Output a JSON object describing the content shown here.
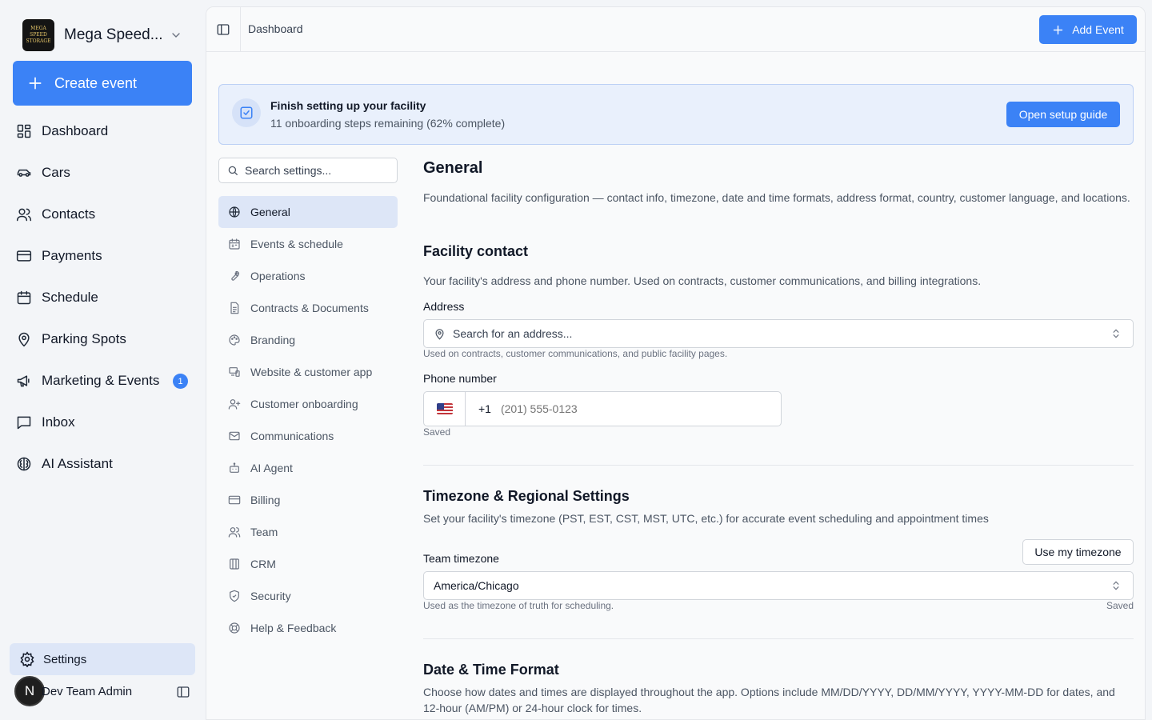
{
  "app": {
    "brand_name": "Mega Speed...",
    "brand_logo_text": "MEGA SPEED STORAGE",
    "create_event_label": "Create event"
  },
  "sidebar": {
    "items": [
      {
        "label": "Dashboard",
        "icon": "dashboard-icon"
      },
      {
        "label": "Cars",
        "icon": "car-icon"
      },
      {
        "label": "Contacts",
        "icon": "contacts-icon"
      },
      {
        "label": "Payments",
        "icon": "credit-card-icon"
      },
      {
        "label": "Schedule",
        "icon": "calendar-icon"
      },
      {
        "label": "Parking Spots",
        "icon": "map-pin-icon"
      },
      {
        "label": "Marketing & Events",
        "icon": "megaphone-icon",
        "badge": "1"
      },
      {
        "label": "Inbox",
        "icon": "message-icon"
      },
      {
        "label": "AI Assistant",
        "icon": "brain-icon"
      }
    ],
    "settings_label": "Settings",
    "user": {
      "initial": "N",
      "name": "Dev Team Admin"
    }
  },
  "header": {
    "breadcrumb": "Dashboard",
    "add_event_label": "Add Event"
  },
  "banner": {
    "title": "Finish setting up your facility",
    "subtitle": "11 onboarding steps remaining (62% complete)",
    "button_label": "Open setup guide"
  },
  "settings_nav": {
    "search_placeholder": "Search settings...",
    "items": [
      {
        "label": "General",
        "icon": "globe-icon",
        "active": true
      },
      {
        "label": "Events & schedule",
        "icon": "calendar-icon"
      },
      {
        "label": "Operations",
        "icon": "wrench-icon"
      },
      {
        "label": "Contracts & Documents",
        "icon": "document-icon"
      },
      {
        "label": "Branding",
        "icon": "palette-icon"
      },
      {
        "label": "Website & customer app",
        "icon": "devices-icon"
      },
      {
        "label": "Customer onboarding",
        "icon": "user-plus-icon"
      },
      {
        "label": "Communications",
        "icon": "mail-icon"
      },
      {
        "label": "AI Agent",
        "icon": "bot-icon"
      },
      {
        "label": "Billing",
        "icon": "credit-card-icon"
      },
      {
        "label": "Team",
        "icon": "users-icon"
      },
      {
        "label": "CRM",
        "icon": "crm-icon"
      },
      {
        "label": "Security",
        "icon": "shield-icon"
      },
      {
        "label": "Help & Feedback",
        "icon": "lifebuoy-icon"
      }
    ]
  },
  "general": {
    "title": "General",
    "description": "Foundational facility configuration — contact info, timezone, date and time formats, address format, country, customer language, and locations."
  },
  "facility_contact": {
    "title": "Facility contact",
    "description": "Your facility's address and phone number. Used on contracts, customer communications, and billing integrations.",
    "address_label": "Address",
    "address_placeholder": "Search for an address...",
    "address_hint": "Used on contracts, customer communications, and public facility pages.",
    "phone_label": "Phone number",
    "phone_country_code": "+1",
    "phone_placeholder": "(201) 555-0123",
    "phone_status": "Saved"
  },
  "timezone": {
    "title": "Timezone & Regional Settings",
    "description": "Set your facility's timezone (PST, EST, CST, MST, UTC, etc.) for accurate event scheduling and appointment times",
    "use_my_timezone_label": "Use my timezone",
    "team_timezone_label": "Team timezone",
    "value": "America/Chicago",
    "hint": "Used as the timezone of truth for scheduling.",
    "status": "Saved"
  },
  "date_time": {
    "title": "Date & Time Format",
    "description": "Choose how dates and times are displayed throughout the app. Options include MM/DD/YYYY, DD/MM/YYYY, YYYY-MM-DD for dates, and 12-hour (AM/PM) or 24-hour clock for times."
  },
  "colors": {
    "accent": "#3b82f6",
    "active_nav_bg": "#dde6f7",
    "banner_bg": "#e9f0fc"
  }
}
